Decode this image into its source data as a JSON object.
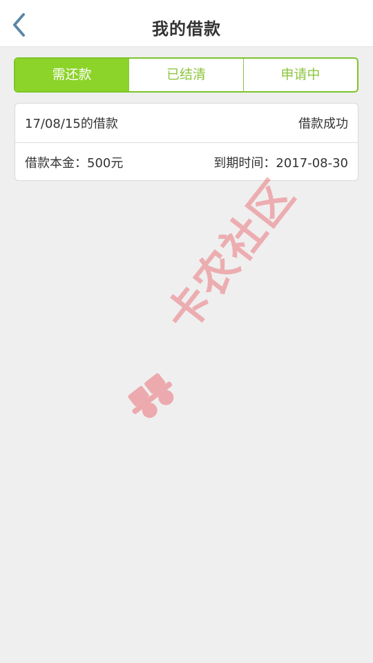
{
  "header": {
    "title": "我的借款"
  },
  "tabs": [
    {
      "label": "需还款",
      "active": true
    },
    {
      "label": "已结清",
      "active": false
    },
    {
      "label": "申请中",
      "active": false
    }
  ],
  "loan": {
    "date_title": "17/08/15的借款",
    "status": "借款成功",
    "principal": "借款本金：500元",
    "due_date": "到期时间：2017-08-30"
  },
  "watermark": {
    "text": "卡农社区",
    "icon": "kanong-logo-icon",
    "color": "#e8444e"
  },
  "colors": {
    "accent": "#8cd32a",
    "tab_text": "#8cc63e",
    "back_icon": "#5b86a8"
  }
}
